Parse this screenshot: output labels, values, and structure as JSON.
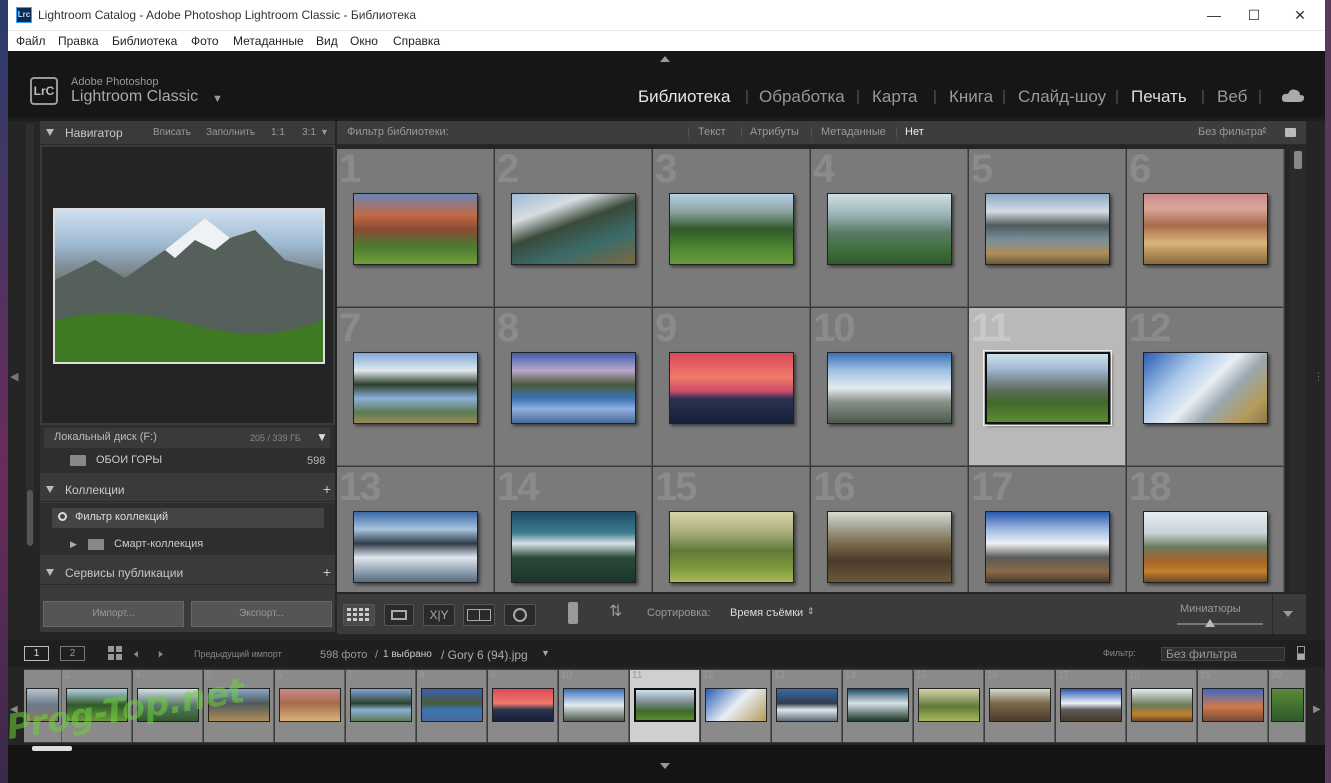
{
  "window": {
    "title": "Lightroom Catalog - Adobe Photoshop Lightroom Classic - Библиотека",
    "app_icon": "Lrc"
  },
  "menu": [
    "Файл",
    "Правка",
    "Библиотека",
    "Фото",
    "Метаданные",
    "Вид",
    "Окно",
    "Справка"
  ],
  "identity": {
    "vendor": "Adobe Photoshop",
    "product": "Lightroom Classic",
    "logo": "LrC"
  },
  "modules": [
    "Библиотека",
    "Обработка",
    "Карта",
    "Книга",
    "Слайд-шоу",
    "Печать",
    "Веб"
  ],
  "active_module": "Библиотека",
  "navigator": {
    "title": "Навигатор",
    "zoom_options": [
      "Вписать",
      "Заполнить",
      "1:1",
      "3:1"
    ]
  },
  "folders": {
    "drive": "Локальный диск (F:)",
    "drive_space": "205 / 339 ГБ",
    "folder": "ОБОИ ГОРЫ",
    "folder_count": "598"
  },
  "collections": {
    "title": "Коллекции",
    "filter": "Фильтр коллекций",
    "smart": "Смарт-коллекция"
  },
  "publish": {
    "title": "Сервисы публикации"
  },
  "buttons": {
    "import": "Импорт...",
    "export": "Экспорт..."
  },
  "filterbar": {
    "label": "Фильтр библиотеки:",
    "text": "Текст",
    "attributes": "Атрибуты",
    "metadata": "Метаданные",
    "none": "Нет",
    "preset": "Без фильтра"
  },
  "grid_numbers": [
    "1",
    "2",
    "3",
    "4",
    "5",
    "6",
    "7",
    "8",
    "9",
    "10",
    "11",
    "12",
    "13",
    "14",
    "15",
    "16",
    "17",
    "18"
  ],
  "selected_index": 11,
  "toolbar": {
    "sort_label": "Сортировка:",
    "sort_value": "Время съёмки",
    "thumbs_label": "Миниатюры"
  },
  "filmstrip_bar": {
    "page1": "1",
    "page2": "2",
    "source": "Предыдущий импорт",
    "count": "598 фото",
    "slash": "/",
    "selected_count": "1 выбрано",
    "file": "/ Gory 6 (94).jpg",
    "filter_label": "Фильтр:",
    "filter_value": "Без фильтра"
  },
  "film_numbers": [
    "",
    "3",
    "4",
    "5",
    "6",
    "7",
    "8",
    "9",
    "10",
    "11",
    "12",
    "13",
    "14",
    "15",
    "16",
    "17",
    "18",
    "19",
    "20"
  ],
  "watermark": "Prog-Top.net"
}
